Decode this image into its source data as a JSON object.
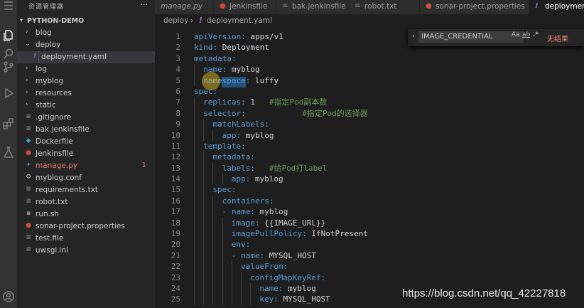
{
  "sidebar": {
    "title": "资源管理器",
    "more": "···",
    "section": "PYTHON-DEMO",
    "items": [
      {
        "name": "blog",
        "type": "folder"
      },
      {
        "name": "deploy",
        "type": "folder-open"
      },
      {
        "name": "deployment.yaml",
        "type": "yaml",
        "icon": "!"
      },
      {
        "name": "log",
        "type": "folder"
      },
      {
        "name": "myblog",
        "type": "folder"
      },
      {
        "name": "resources",
        "type": "folder"
      },
      {
        "name": "static",
        "type": "folder"
      },
      {
        "name": ".gitignore",
        "type": "file"
      },
      {
        "name": "bak.jenkinsfile",
        "type": "file"
      },
      {
        "name": "Dockerfile",
        "type": "docker"
      },
      {
        "name": "Jenkinsfile",
        "type": "jenkins"
      },
      {
        "name": "manage.py",
        "type": "python",
        "badge": "1"
      },
      {
        "name": "myblog.conf",
        "type": "file"
      },
      {
        "name": "requirements.txt",
        "type": "file"
      },
      {
        "name": "robot.txt",
        "type": "file"
      },
      {
        "name": "run.sh",
        "type": "file"
      },
      {
        "name": "sonar-project.properties",
        "type": "sonar"
      },
      {
        "name": "test.file",
        "type": "file"
      },
      {
        "name": "uwsgi.ini",
        "type": "file"
      }
    ]
  },
  "tabs": [
    {
      "label": "manage.py"
    },
    {
      "label": "Jenkinsfile"
    },
    {
      "label": "bak.jenkinsfile"
    },
    {
      "label": "robot.txt"
    },
    {
      "label": "sonar-project.properties"
    },
    {
      "label": "deployment"
    }
  ],
  "breadcrumb": {
    "folder": "deploy",
    "sep": "›",
    "icon": "!",
    "file": "deployment.yaml"
  },
  "find": {
    "value": "IMAGE_CREDENTIAL",
    "case": "Aa",
    "word": "ab",
    "regex": ".*",
    "result": "无结果"
  },
  "code": [
    {
      "n": "1",
      "indent": 0,
      "key": "apiVersion:",
      "val": " apps/v1",
      "comment": ""
    },
    {
      "n": "2",
      "indent": 0,
      "key": "kind:",
      "val": " Deployment",
      "comment": ""
    },
    {
      "n": "3",
      "indent": 0,
      "key": "metadata:",
      "val": "",
      "comment": ""
    },
    {
      "n": "4",
      "indent": 1,
      "key": "name:",
      "val": " myblog",
      "comment": ""
    },
    {
      "n": "5",
      "indent": 1,
      "key": "namespace:",
      "val": " luffy",
      "comment": ""
    },
    {
      "n": "6",
      "indent": 0,
      "key": "spec:",
      "val": "",
      "comment": ""
    },
    {
      "n": "7",
      "indent": 1,
      "key": "replicas:",
      "val": " 1   ",
      "comment": "#指定Pod副本数"
    },
    {
      "n": "8",
      "indent": 1,
      "key": "selector:",
      "val": "            ",
      "comment": "#指定Pod的选择器"
    },
    {
      "n": "9",
      "indent": 2,
      "key": "matchLabels:",
      "val": "",
      "comment": ""
    },
    {
      "n": "10",
      "indent": 3,
      "key": "app:",
      "val": " myblog",
      "comment": ""
    },
    {
      "n": "11",
      "indent": 1,
      "key": "template:",
      "val": "",
      "comment": ""
    },
    {
      "n": "12",
      "indent": 2,
      "key": "metadata:",
      "val": "",
      "comment": ""
    },
    {
      "n": "13",
      "indent": 3,
      "key": "labels:",
      "val": "   ",
      "comment": "#给Pod打label"
    },
    {
      "n": "14",
      "indent": 4,
      "key": "app:",
      "val": " myblog",
      "comment": ""
    },
    {
      "n": "15",
      "indent": 2,
      "key": "spec:",
      "val": "",
      "comment": ""
    },
    {
      "n": "16",
      "indent": 3,
      "key": "containers:",
      "val": "",
      "comment": ""
    },
    {
      "n": "17",
      "indent": 3,
      "key": "- name:",
      "val": " myblog",
      "comment": ""
    },
    {
      "n": "18",
      "indent": 4,
      "key": "image:",
      "val": " {{IMAGE_URL}}",
      "comment": ""
    },
    {
      "n": "19",
      "indent": 4,
      "key": "imagePullPolicy:",
      "val": " IfNotPresent",
      "comment": ""
    },
    {
      "n": "20",
      "indent": 4,
      "key": "env:",
      "val": "",
      "comment": ""
    },
    {
      "n": "21",
      "indent": 4,
      "key": "- name:",
      "val": " MYSQL_HOST",
      "comment": ""
    },
    {
      "n": "22",
      "indent": 5,
      "key": "valueFrom:",
      "val": "",
      "comment": ""
    },
    {
      "n": "23",
      "indent": 6,
      "key": "configMapKeyRef:",
      "val": "",
      "comment": ""
    },
    {
      "n": "24",
      "indent": 7,
      "key": "name:",
      "val": " myblog",
      "comment": ""
    },
    {
      "n": "25",
      "indent": 7,
      "key": "key:",
      "val": " MYSQL_HOST",
      "comment": ""
    }
  ],
  "watermark": "https://blog.csdn.net/qq_42227818",
  "colors": {
    "keyword": "#569cd6",
    "comment": "#6a9955",
    "error_badge": "#e2786f"
  }
}
